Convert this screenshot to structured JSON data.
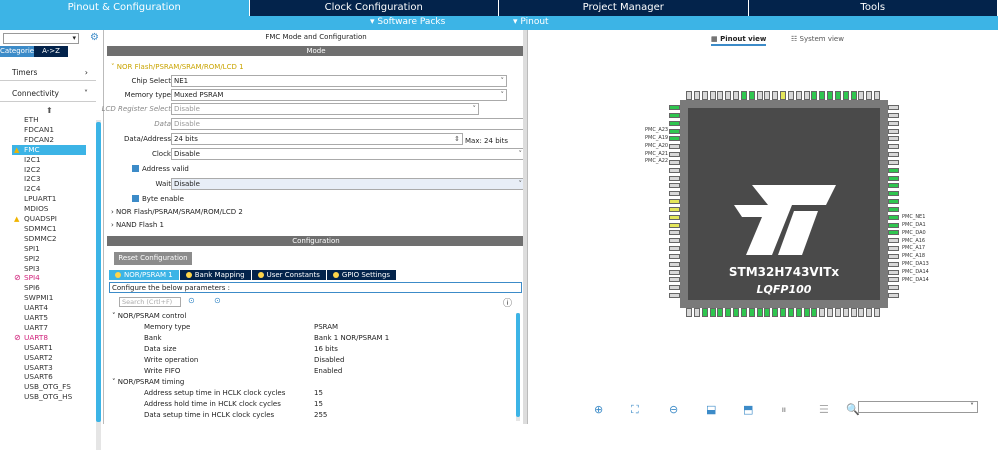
{
  "tabs": [
    "Pinout & Configuration",
    "Clock Configuration",
    "Project Manager",
    "Tools"
  ],
  "subbar": {
    "software_packs": "▾ Software Packs",
    "pinout": "▾ Pinout"
  },
  "left": {
    "categories": "Categories",
    "az": "A->Z",
    "timers": "Timers",
    "connectivity": "Connectivity",
    "peripherals": [
      "ETH",
      "FDCAN1",
      "FDCAN2",
      "FMC",
      "I2C1",
      "I2C2",
      "I2C3",
      "I2C4",
      "LPUART1",
      "MDIOS",
      "QUADSPI",
      "SDMMC1",
      "SDMMC2",
      "SPI1",
      "SPI2",
      "SPI3",
      "SPI4",
      "SPI6",
      "SWPMI1",
      "UART4",
      "UART5",
      "UART7",
      "UART8",
      "USART1",
      "USART2",
      "USART3",
      "USART6",
      "USB_OTG_FS",
      "USB_OTG_HS"
    ]
  },
  "mode": {
    "title": "FMC Mode and Configuration",
    "mode_hdr": "Mode",
    "nor1": "NOR Flash/PSRAM/SRAM/ROM/LCD 1",
    "rows": [
      {
        "label": "Chip Select",
        "value": "NE1"
      },
      {
        "label": "Memory type",
        "value": "Muxed PSRAM"
      },
      {
        "label": "LCD Register Select",
        "value": "Disable"
      },
      {
        "label": "Data",
        "value": "Disable"
      },
      {
        "label": "Data/Address",
        "value": "24 bits"
      },
      {
        "label": "Clock",
        "value": "Disable"
      },
      {
        "label": "Wait",
        "value": "Disable"
      }
    ],
    "max": "Max: 24 bits",
    "address_valid": "Address valid",
    "byte_enable": "Byte enable",
    "nor2": "NOR Flash/PSRAM/SRAM/ROM/LCD 2",
    "nand": "NAND Flash 1"
  },
  "config": {
    "hdr": "Configuration",
    "reset": "Reset Configuration",
    "tabs": [
      "NOR/PSRAM 1",
      "Bank Mapping",
      "User Constants",
      "GPIO Settings"
    ],
    "configure": "Configure the below parameters :",
    "search": "Search (Crtl+F)",
    "group1": "NOR/PSRAM control",
    "params1": [
      [
        "Memory type",
        "PSRAM"
      ],
      [
        "Bank",
        "Bank 1 NOR/PSRAM 1"
      ],
      [
        "Data size",
        "16 bits"
      ],
      [
        "Write operation",
        "Disabled"
      ],
      [
        "Write FIFO",
        "Enabled"
      ]
    ],
    "group2": "NOR/PSRAM timing",
    "params2": [
      [
        "Address setup time in HCLK clock cycles",
        "15"
      ],
      [
        "Address hold time in HCLK clock cycles",
        "15"
      ],
      [
        "Data setup time in HCLK clock cycles",
        "255"
      ]
    ]
  },
  "right": {
    "pinout_view": "Pinout view",
    "system_view": "System view",
    "chip_name": "STM32H743VITx",
    "package": "LQFP100",
    "left_pin_labels": [
      "PMC_A23",
      "PMC_A19",
      "PMC_A20",
      "PMC_A21",
      "PMC_A22"
    ],
    "right_pin_labels": [
      "PMC_NE1",
      "PMC_DA1",
      "PMC_DA0",
      "PMC_A16",
      "PMC_A17",
      "PMC_A18",
      "PMC_DA13",
      "PMC_DA14",
      "PMC_DA14"
    ]
  }
}
